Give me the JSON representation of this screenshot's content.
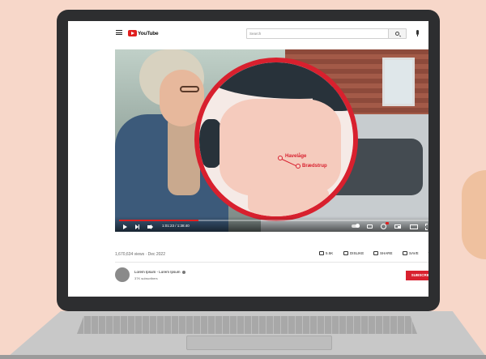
{
  "header": {
    "logo_text": "YouTube",
    "search_placeholder": "Search"
  },
  "map": {
    "places": [
      "Havelåge",
      "Brædstrup"
    ]
  },
  "player": {
    "time": "1:01:23 / 1:38:40",
    "progress_fraction": 0.25
  },
  "meta": {
    "views_date": "1,670,634 views · Dec 2022",
    "likes": "5.5K",
    "dislike_label": "DISLIKE",
    "share_label": "SHARE",
    "save_label": "SAVE",
    "more_label": "···"
  },
  "channel": {
    "name": "Lorem Ipsum - Lorem Ipsum",
    "subscribers": "37K subscribers",
    "subscribe_label": "SUBSCRIBE"
  },
  "colors": {
    "accent": "#e01f1f",
    "map_border": "#d8202e",
    "background": "#f7d7c9"
  }
}
